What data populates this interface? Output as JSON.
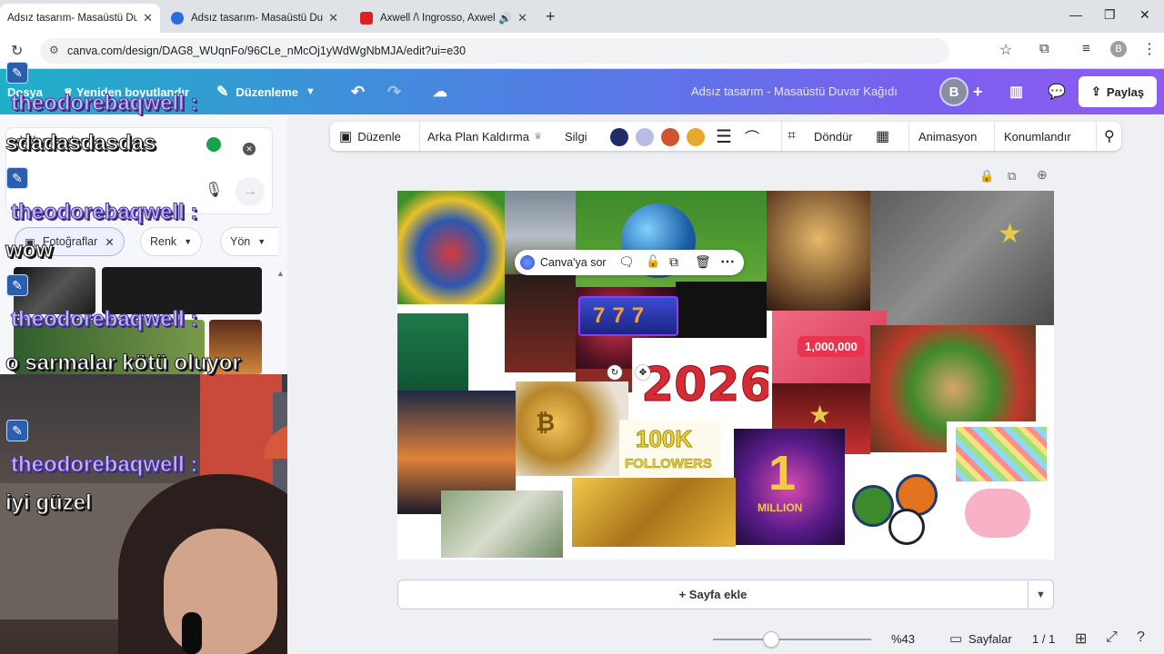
{
  "browser": {
    "tabs": [
      {
        "title": "Adsız tasarım- Masaüstü Duvar",
        "active": true
      },
      {
        "title": "Adsız tasarım- Masaüstü Duvar",
        "active": false
      },
      {
        "title": "Axwell /\\ Ingrosso, Axwell, S",
        "active": false
      }
    ],
    "url": "canva.com/design/DAG8_WUqnFo/96CLe_nMcOj1yWdWgNbMJA/edit?ui=e30",
    "profile_initial": "B"
  },
  "canva": {
    "menu_file": "Dosya",
    "menu_resize": "Yeniden boyutlandır",
    "menu_edit": "Düzenleme",
    "doc_title": "Adsız tasarım - Masaüstü Duvar Kağıdı",
    "avatar_initial": "B",
    "share_label": "Paylaş"
  },
  "left_panel": {
    "search_value": "sdadasdasdas",
    "chips": [
      "Fotoğraflar",
      "Renk",
      "Yön"
    ]
  },
  "chat": {
    "messages": [
      {
        "user": "theodorebaqwell :",
        "text": "sdadasdasdas"
      },
      {
        "user": "theodorebaqwell :",
        "text": "wow"
      },
      {
        "user": "theodorebaqwell :",
        "text": "o sarmalar kötü oluyor"
      },
      {
        "user": "theodorebaqwell :",
        "text": "iyi güzel"
      }
    ]
  },
  "context_toolbar": {
    "edit": "Düzenle",
    "bg_remove": "Arka Plan Kaldırma",
    "eraser": "Silgi",
    "rotate": "Döndür",
    "animate": "Animasyon",
    "position": "Konumlandır",
    "swatches": [
      "#1f2d6b",
      "#b8bde6",
      "#d2542e",
      "#e8a92b"
    ]
  },
  "floating_toolbar": {
    "ask_canva": "Canva'ya sor"
  },
  "canvas_texts": {
    "year": "2026",
    "followers_top": "100K",
    "followers_bottom": "FOLLOWERS",
    "likes": "1,000,000",
    "million_num": "1",
    "million": "MILLION",
    "slot": "777"
  },
  "editor": {
    "add_page": "+ Sayfa ekle",
    "zoom": "%43",
    "zoom_fraction": 0.37,
    "pages_label": "Sayfalar",
    "page_count": "1 / 1"
  }
}
